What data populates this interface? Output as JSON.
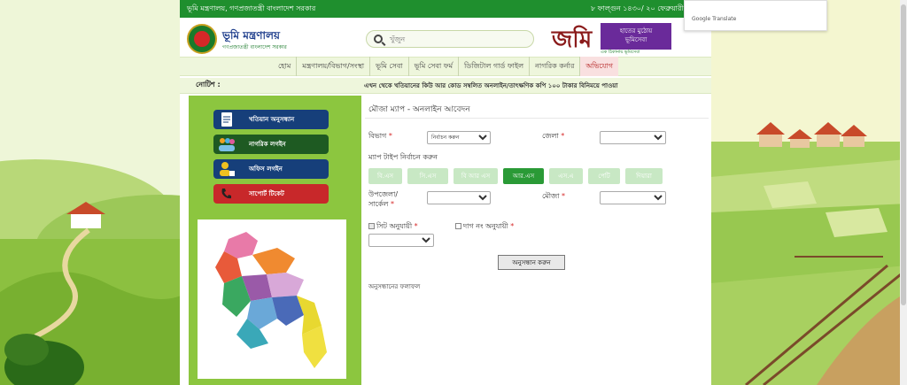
{
  "topbar": {
    "left": "ভূমি মন্ত্রণালয়, গণপ্রজাতন্ত্রী বাংলাদেশ সরকার",
    "right": "৮ ফাল্গুন ১৪৩০/ ২০ ফেব্রুয়ারী ২০২৪"
  },
  "brand": {
    "title": "ভূমি মন্ত্রণালয়",
    "subtitle": "গণপ্রজাতন্ত্রী বাংলাদেশ সরকার"
  },
  "search": {
    "placeholder": "খুঁজুন"
  },
  "jomi": {
    "logo": "জমি",
    "box_line1": "হাতের মুঠোয়",
    "box_line2": "ভূমিসেবা",
    "tag": "এক ঠিকানায় ভূমিসেবা"
  },
  "nav": [
    "হোম",
    "মন্ত্রণালয়/বিভাগ/সংস্থা",
    "ভূমি সেবা",
    "ভূমি সেবা ফর্ম",
    "ডিজিটাল গার্ড ফাইল",
    "নাগরিক কর্নার",
    "অভিযোগ"
  ],
  "notice": {
    "label": "নোটিশ :",
    "text": "এখন থেকে খতিয়ানের কিউ আর কোড সম্বলিত অনলাইন/তাৎক্ষণিক কপি ১০০ টাকার বিনিময়ে পাওয়া"
  },
  "sidebar": [
    "খতিয়ান অনুসন্ধান",
    "নাগরিক লগইন",
    "অফিস লগইন",
    "সাপোর্ট টিকেট"
  ],
  "form": {
    "title": "মৌজা ম্যাপ - অনলাইন আবেদন",
    "division_label": "বিভাগ",
    "division_value": "নির্বাচন করুন",
    "district_label": "জেলা",
    "map_type_label": "ম্যাপ টাইপ নির্বাচন করুন",
    "map_types": [
      "বি.এস",
      "সি.এস",
      "বি আর এস",
      "আর.এস",
      "এস.এ",
      "পেটি",
      "দিয়ারা"
    ],
    "upazila_label": "উপজেলা/",
    "circle_label": "সার্কেল",
    "mouza_label": "মৌজা",
    "sheet_label": "সিট অনুযায়ী",
    "dag_label": "দাগ নং অনুযায়ী",
    "search_button": "অনুসন্ধান করুন",
    "results_label": "অনুসন্ধানের ফলাফল"
  },
  "google_translate": "Google Translate"
}
